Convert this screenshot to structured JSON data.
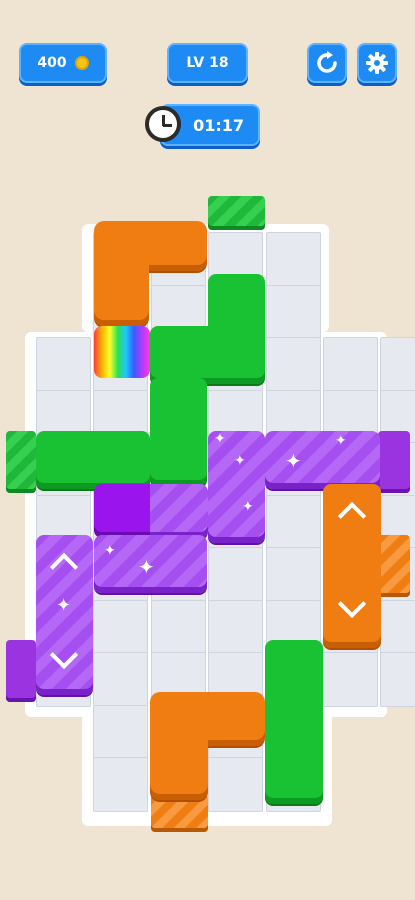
{
  "hud": {
    "coins": "400",
    "level": "LV 18",
    "timer": "01:17"
  },
  "icons": {
    "coin": "coin-icon",
    "restart": "restart-icon",
    "settings": "gear-icon",
    "timer": "clock-icon"
  },
  "colors": {
    "background": "#efe3d1",
    "hud_blue": "#1e8bf4",
    "orange": "#f07d12",
    "green": "#18c233",
    "purple": "#a64ff0"
  }
}
